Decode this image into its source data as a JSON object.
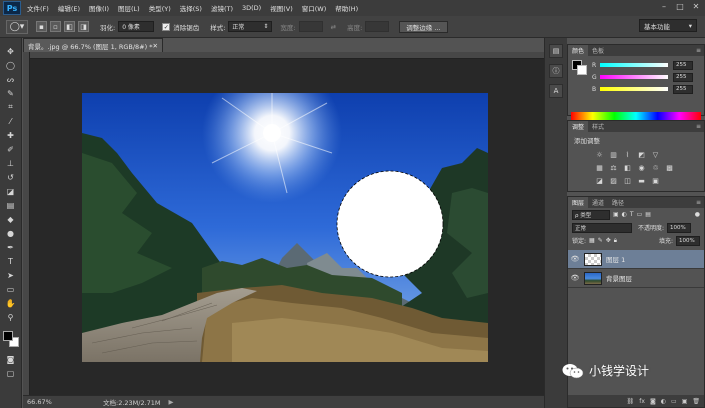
{
  "app": {
    "logo": "Ps"
  },
  "menu": [
    "文件(F)",
    "编辑(E)",
    "图像(I)",
    "图层(L)",
    "类型(Y)",
    "选择(S)",
    "滤镜(T)",
    "3D(D)",
    "视图(V)",
    "窗口(W)",
    "帮助(H)"
  ],
  "window_controls": {
    "minimize": "–",
    "maximize": "□",
    "close": "✕"
  },
  "options": {
    "feather_label": "羽化:",
    "feather_value": "0 像素",
    "antialias_label": "消除锯齿",
    "style_label": "样式:",
    "style_value": "正常",
    "width_label": "宽度:",
    "height_label": "高度:",
    "refine_edge": "调整边缘 ...",
    "workspace": "基本功能"
  },
  "document": {
    "tab_title": "背景。.jpg @ 66.7% (图层 1, RGB/8#) *",
    "zoom": "66.67%",
    "doc_info": "文档:2.23M/2.71M"
  },
  "color_panel": {
    "tabs": [
      "颜色",
      "色板"
    ],
    "channels": [
      {
        "name": "R",
        "value": "255",
        "gradient": "#00ffff"
      },
      {
        "name": "G",
        "value": "255",
        "gradient": "#ff00ff"
      },
      {
        "name": "B",
        "value": "255",
        "gradient": "#ffff00"
      }
    ]
  },
  "adjustments_panel": {
    "tabs": [
      "调整",
      "样式"
    ],
    "title": "添加调整"
  },
  "layers_panel": {
    "tabs": [
      "图层",
      "通道",
      "路径"
    ],
    "filter_kind": "ρ 类型",
    "blend_mode": "正常",
    "opacity_label": "不透明度:",
    "opacity_value": "100%",
    "lock_label": "锁定:",
    "fill_label": "填充:",
    "fill_value": "100%",
    "layers": [
      {
        "name": "图层 1",
        "selected": true
      },
      {
        "name": "背景图层",
        "selected": false
      }
    ]
  },
  "watermark": {
    "text": "小钱学设计"
  }
}
